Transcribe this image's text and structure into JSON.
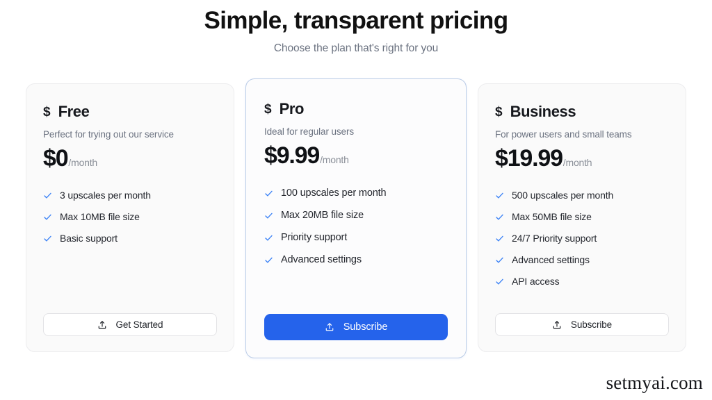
{
  "header": {
    "title": "Simple, transparent pricing",
    "subtitle": "Choose the plan that's right for you"
  },
  "colors": {
    "accent": "#2563eb",
    "check": "#3b82f6",
    "page_background": "#ffffff",
    "card_background": "#fafafa",
    "featured_border": "#b9cbe6",
    "title": "#111111",
    "muted_text": "#6b7280"
  },
  "plans": [
    {
      "id": "free",
      "currency_symbol": "$",
      "name": "Free",
      "description": "Perfect for trying out our service",
      "price": "$0",
      "period": "/month",
      "featured": false,
      "features": [
        "3 upscales per month",
        "Max 10MB file size",
        "Basic support"
      ],
      "cta": {
        "label": "Get Started",
        "icon": "upload-icon",
        "style": "outline"
      }
    },
    {
      "id": "pro",
      "currency_symbol": "$",
      "name": "Pro",
      "description": "Ideal for regular users",
      "price": "$9.99",
      "period": "/month",
      "featured": true,
      "features": [
        "100 upscales per month",
        "Max 20MB file size",
        "Priority support",
        "Advanced settings"
      ],
      "cta": {
        "label": "Subscribe",
        "icon": "upload-icon",
        "style": "primary"
      }
    },
    {
      "id": "business",
      "currency_symbol": "$",
      "name": "Business",
      "description": "For power users and small teams",
      "price": "$19.99",
      "period": "/month",
      "featured": false,
      "features": [
        "500 upscales per month",
        "Max 50MB file size",
        "24/7 Priority support",
        "Advanced settings",
        "API access"
      ],
      "cta": {
        "label": "Subscribe",
        "icon": "upload-icon",
        "style": "outline"
      }
    }
  ],
  "watermark": "setmyai.com"
}
